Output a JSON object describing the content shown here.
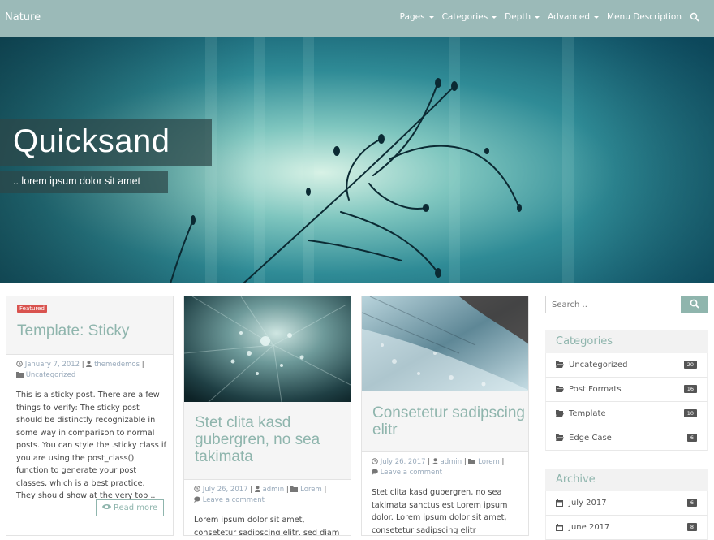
{
  "brand": "Nature",
  "nav": {
    "items": [
      {
        "label": "Pages",
        "dropdown": true
      },
      {
        "label": "Categories",
        "dropdown": true
      },
      {
        "label": "Depth",
        "dropdown": true
      },
      {
        "label": "Advanced",
        "dropdown": true
      },
      {
        "label": "Menu Description",
        "dropdown": false
      }
    ],
    "search_icon": "search-icon"
  },
  "hero": {
    "title": "Quicksand",
    "subtitle": ".. lorem ipsum dolor sit amet"
  },
  "posts": [
    {
      "badge": "Featured",
      "title": "Template: Sticky",
      "date": "January 7, 2012",
      "author": "themedemos",
      "category": "Uncategorized",
      "excerpt": "This is a sticky post. There are a few things to verify: The sticky post should be distinctly recognizable in some way in comparison to normal posts. You can style the .sticky class if you are using the post_class() function to generate your post classes, which is a best practice. They should show at the very top ..",
      "read_more": "Read more"
    },
    {
      "title": "Stet clita kasd gubergren, no sea takimata",
      "date": "July 26, 2017",
      "author": "admin",
      "category": "Lorem",
      "comment": "Leave a comment",
      "excerpt": "Lorem ipsum dolor sit amet, consetetur sadipscing elitr, sed diam nonumy"
    },
    {
      "title": "Consetetur sadipscing elitr",
      "date": "July 26, 2017",
      "author": "admin",
      "category": "Lorem",
      "comment": "Leave a comment",
      "excerpt": "Stet clita kasd gubergren, no sea takimata sanctus est Lorem ipsum dolor. Lorem ipsum dolor sit amet, consetetur sadipscing elitr"
    }
  ],
  "sidebar": {
    "search_placeholder": "Search ..",
    "categories": {
      "title": "Categories",
      "items": [
        {
          "label": "Uncategorized",
          "count": "20"
        },
        {
          "label": "Post Formats",
          "count": "16"
        },
        {
          "label": "Template",
          "count": "10"
        },
        {
          "label": "Edge Case",
          "count": "6"
        }
      ]
    },
    "archive": {
      "title": "Archive",
      "items": [
        {
          "label": "July 2017",
          "count": "6"
        },
        {
          "label": "June 2017",
          "count": "8"
        }
      ]
    }
  },
  "colors": {
    "accent": "#8fb5ad",
    "topbar": "#9bbab8",
    "badge": "#d9534f"
  }
}
